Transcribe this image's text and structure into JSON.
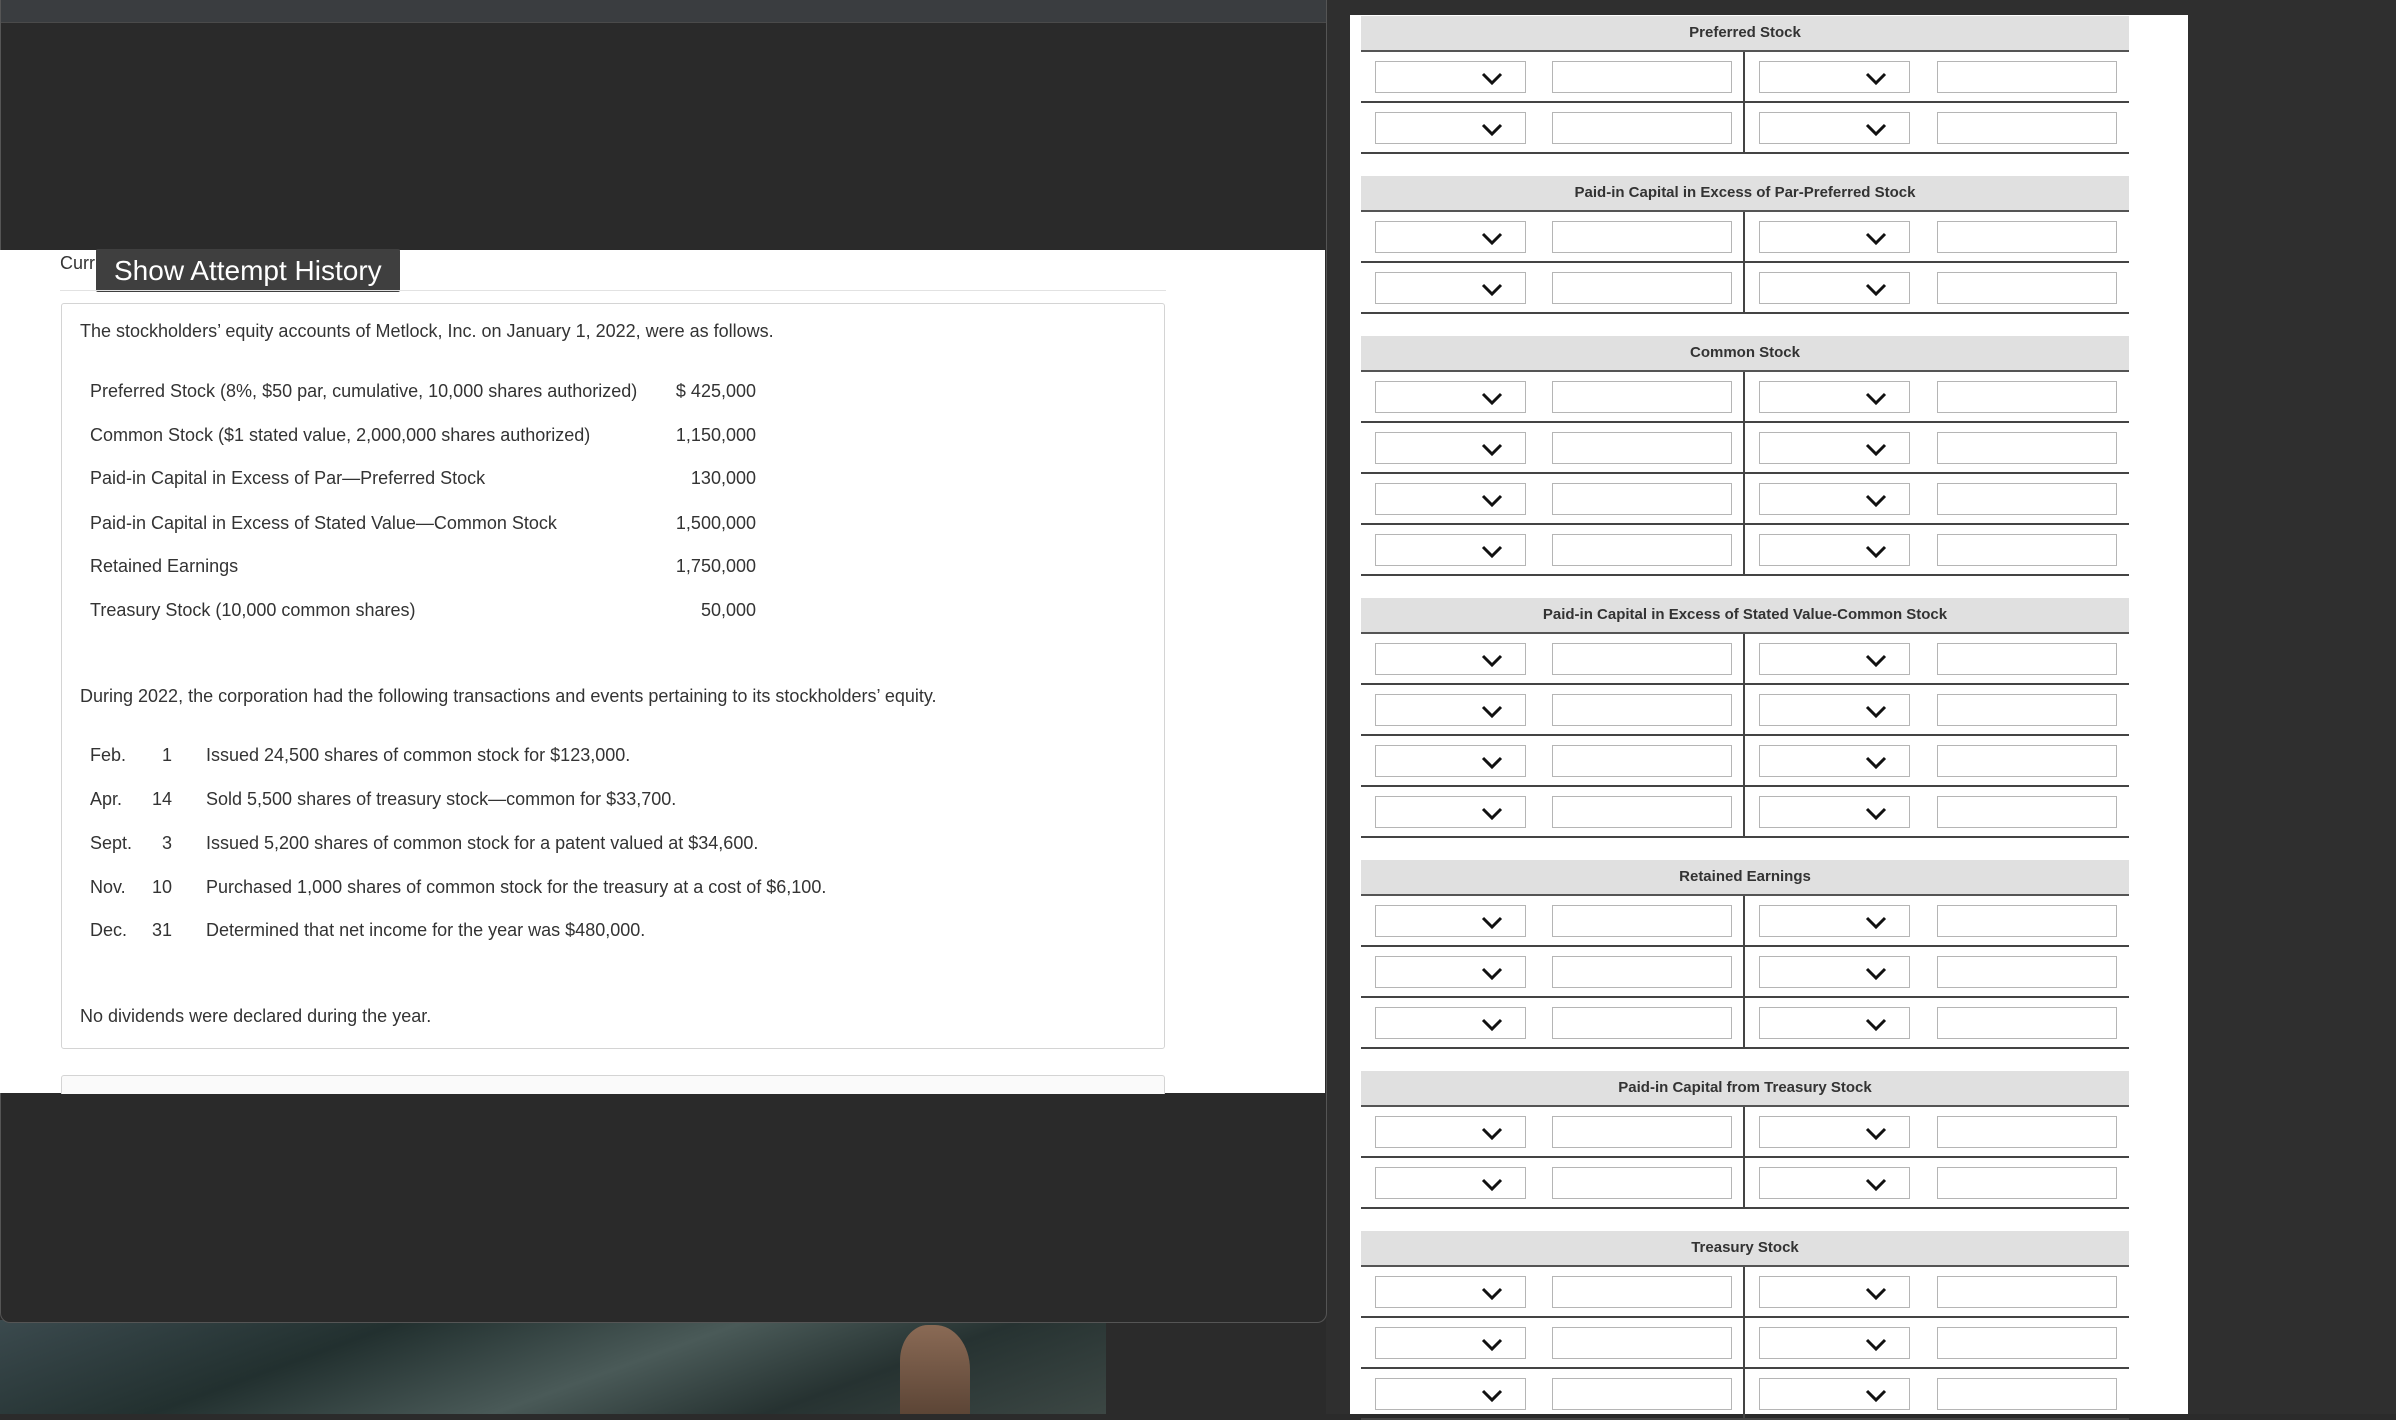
{
  "window": {
    "cur_label": "Curr",
    "tooltip": "Show Attempt History"
  },
  "problem": {
    "intro": "The stockholders’ equity accounts of Metlock, Inc. on January 1, 2022, were as follows.",
    "accounts": [
      {
        "name": "Preferred Stock (8%, $50 par, cumulative, 10,000 shares authorized)",
        "amount": "$ 425,000"
      },
      {
        "name": "Common Stock ($1 stated value, 2,000,000 shares authorized)",
        "amount": "1,150,000"
      },
      {
        "name": "Paid-in Capital in Excess of Par—Preferred Stock",
        "amount": "130,000"
      },
      {
        "name": "Paid-in Capital in Excess of Stated Value—Common Stock",
        "amount": "1,500,000"
      },
      {
        "name": "Retained Earnings",
        "amount": "1,750,000"
      },
      {
        "name": "Treasury Stock (10,000 common shares)",
        "amount": "50,000"
      }
    ],
    "during": "During 2022, the corporation had the following transactions and events pertaining to its stockholders’ equity.",
    "transactions": [
      {
        "month": "Feb.",
        "day": "1",
        "desc": "Issued 24,500 shares of common stock for $123,000."
      },
      {
        "month": "Apr.",
        "day": "14",
        "desc": "Sold 5,500 shares of treasury stock—common for $33,700."
      },
      {
        "month": "Sept.",
        "day": "3",
        "desc": "Issued 5,200 shares of common stock for a patent valued at $34,600."
      },
      {
        "month": "Nov.",
        "day": "10",
        "desc": "Purchased 1,000 shares of common stock for the treasury at a cost of $6,100."
      },
      {
        "month": "Dec.",
        "day": "31",
        "desc": "Determined that net income for the year was $480,000."
      }
    ],
    "footer": "No dividends were declared during the year."
  },
  "ledger": {
    "accounts": [
      {
        "title": "Preferred Stock",
        "rows": 2
      },
      {
        "title": "Paid-in Capital in Excess of Par-Preferred Stock",
        "rows": 2
      },
      {
        "title": "Common Stock",
        "rows": 4
      },
      {
        "title": "Paid-in Capital in Excess of Stated Value-Common Stock",
        "rows": 4
      },
      {
        "title": "Retained Earnings",
        "rows": 3
      },
      {
        "title": "Paid-in Capital from Treasury Stock",
        "rows": 2
      },
      {
        "title": "Treasury Stock",
        "rows": 3
      }
    ],
    "chevron_icon": "chevron-down-icon"
  }
}
